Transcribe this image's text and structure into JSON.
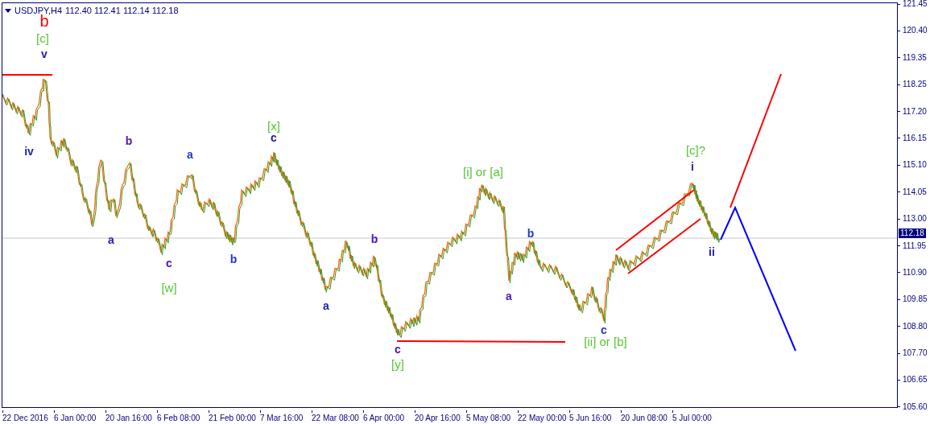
{
  "header": {
    "symbol": "USDJPY,H4",
    "quotes": "112.40 112.41 112.14 112.18"
  },
  "wave_labels": [
    {
      "text": "b",
      "color": "#ff0000"
    },
    {
      "text": "[c]",
      "color": "#55c833"
    },
    {
      "text": "v",
      "color": "#2222a8"
    },
    {
      "text": "iv",
      "color": "#2222a8"
    },
    {
      "text": "a",
      "color": "#2222a8"
    },
    {
      "text": "b",
      "color": "#4b16b0"
    },
    {
      "text": "c",
      "color": "#4b16b0"
    },
    {
      "text": "[w]",
      "color": "#55c833"
    },
    {
      "text": "a",
      "color": "#1e3cc8"
    },
    {
      "text": "b",
      "color": "#1e3cc8"
    },
    {
      "text": "[x]",
      "color": "#55c833"
    },
    {
      "text": "c",
      "color": "#2222a8"
    },
    {
      "text": "a",
      "color": "#2222a8"
    },
    {
      "text": "b",
      "color": "#4b16b0"
    },
    {
      "text": "c",
      "color": "#4b16b0"
    },
    {
      "text": "[y]",
      "color": "#55c833"
    },
    {
      "text": "[i] or [a]",
      "color": "#55c833"
    },
    {
      "text": "a",
      "color": "#4b16b0"
    },
    {
      "text": "b",
      "color": "#1e3cc8"
    },
    {
      "text": "c",
      "color": "#1e3cc8"
    },
    {
      "text": "[ii] or [b]",
      "color": "#55c833"
    },
    {
      "text": "[c]?",
      "color": "#55c833"
    },
    {
      "text": "i",
      "color": "#2222a8"
    },
    {
      "text": "ii",
      "color": "#2222a8"
    }
  ],
  "current_price": "112.18",
  "price_axis": [
    "121.45",
    "120.40",
    "119.35",
    "118.25",
    "117.20",
    "116.15",
    "115.10",
    "114.05",
    "113.00",
    "111.95",
    "110.90",
    "109.85",
    "108.80",
    "107.70",
    "106.65",
    "105.60"
  ],
  "time_axis": [
    "22 Dec 2016",
    "6 Jan 00:00",
    "20 Jan 16:00",
    "6 Feb 08:00",
    "21 Feb 00:00",
    "7 Mar 16:00",
    "22 Mar 08:00",
    "6 Apr 00:00",
    "20 Apr 16:00",
    "5 May 08:00",
    "22 May 00:00",
    "5 Jun 16:00",
    "20 Jun 08:00",
    "5 Jul 00:00"
  ]
}
